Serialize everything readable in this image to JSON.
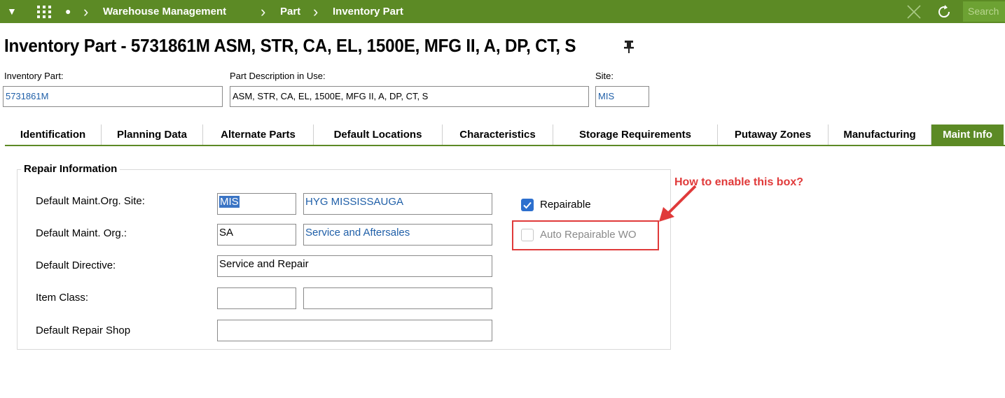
{
  "topbar": {
    "breadcrumb": [
      "Warehouse Management",
      "Part",
      "Inventory Part"
    ],
    "search_placeholder": "Search"
  },
  "page": {
    "title": "Inventory Part - 5731861M ASM, STR, CA, EL, 1500E, MFG II, A, DP, CT, S"
  },
  "header": {
    "inventory_part_label": "Inventory Part:",
    "inventory_part_value": "5731861M",
    "description_label": "Part Description in Use:",
    "description_value": "ASM, STR, CA, EL, 1500E, MFG II, A, DP, CT, S",
    "site_label": "Site:",
    "site_value": "MIS"
  },
  "tabs": [
    {
      "label": "Identification"
    },
    {
      "label": "Planning Data"
    },
    {
      "label": "Alternate Parts"
    },
    {
      "label": "Default Locations"
    },
    {
      "label": "Characteristics"
    },
    {
      "label": "Storage Requirements"
    },
    {
      "label": "Putaway Zones"
    },
    {
      "label": "Manufacturing"
    },
    {
      "label": "Maint Info",
      "active": true
    }
  ],
  "repair_info": {
    "title": "Repair Information",
    "maint_org_site_label": "Default Maint.Org. Site:",
    "maint_org_site_code": "MIS",
    "maint_org_site_name": "HYG MISSISSAUGA",
    "maint_org_label": "Default Maint. Org.:",
    "maint_org_code": "SA",
    "maint_org_name": "Service and Aftersales",
    "directive_label": "Default Directive:",
    "directive_value": "Service and Repair",
    "item_class_label": "Item Class:",
    "item_class_code": "",
    "item_class_name": "",
    "repair_shop_label": "Default Repair Shop",
    "repair_shop_value": "",
    "repairable_label": "Repairable",
    "repairable_checked": true,
    "auto_repairable_label": "Auto Repairable WO",
    "auto_repairable_checked": false
  },
  "annotation": {
    "text": "How to enable this box?",
    "color": "#e03a3a"
  },
  "colors": {
    "brand": "#5c8a25",
    "link": "#1f5fa8",
    "checkbox": "#2c6fce"
  }
}
